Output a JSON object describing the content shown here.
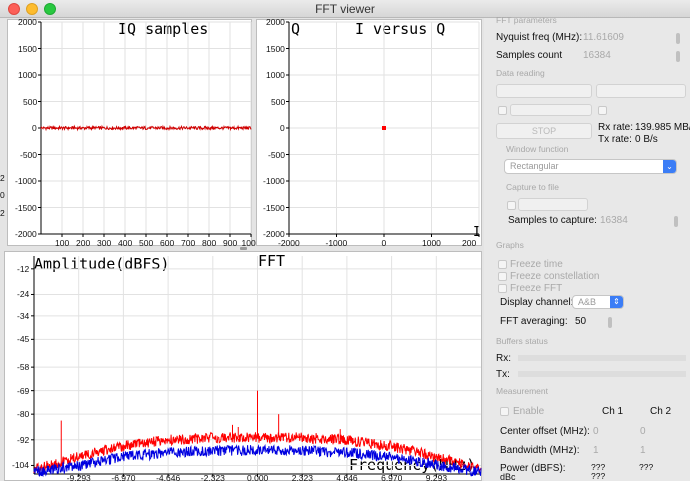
{
  "window": {
    "title": "FFT viewer"
  },
  "iq_plot": {
    "title": "IQ samples",
    "y_ticks": [
      "2000",
      "1500",
      "1000",
      "500",
      "0",
      "-500",
      "-1000",
      "-1500",
      "-2000"
    ],
    "x_ticks": [
      "100",
      "200",
      "300",
      "400",
      "500",
      "600",
      "700",
      "800",
      "900",
      "1000"
    ]
  },
  "iq_vs_plot": {
    "title_left": "Q",
    "title": "I versus Q",
    "corner_label": "I",
    "y_ticks": [
      "2000",
      "1500",
      "1000",
      "500",
      "0",
      "-500",
      "-1000",
      "-1500",
      "-2000"
    ],
    "x_ticks": [
      "-2000",
      "-1000",
      "0",
      "1000",
      "200"
    ]
  },
  "left_edge_ticks": [
    "2",
    "0",
    "2"
  ],
  "fft_plot": {
    "title": "FFT",
    "ylabel": "Amplitude(dBFS)",
    "xlabel": "Frequency(MHz)",
    "y_ticks": [
      "-12",
      "-24",
      "-34",
      "-45",
      "-58",
      "-69",
      "-80",
      "-92",
      "-104"
    ],
    "x_ticks": [
      "-9.293",
      "-6.970",
      "-4.646",
      "-2.323",
      "0.000",
      "2.323",
      "4.646",
      "6.970",
      "9.293"
    ]
  },
  "chart_data": [
    {
      "type": "line",
      "title": "IQ samples",
      "xlim": [
        0,
        1000
      ],
      "ylim": [
        -2000,
        2000
      ],
      "series": [
        {
          "color": "#d00000",
          "x": [
            0,
            1000
          ],
          "y": [
            0,
            0
          ]
        }
      ]
    },
    {
      "type": "scatter",
      "title": "I versus Q",
      "xlim": [
        -2000,
        2000
      ],
      "ylim": [
        -2000,
        2000
      ],
      "series": [
        {
          "color": "#ff0000",
          "x": [
            0
          ],
          "y": [
            0
          ]
        }
      ]
    },
    {
      "type": "line",
      "title": "FFT",
      "xlabel": "Frequency(MHz)",
      "ylabel": "Amplitude(dBFS)",
      "xlim": [
        -11.616,
        11.616
      ],
      "ylim": [
        -108,
        -6
      ],
      "series": [
        {
          "color": "#ff0000",
          "x": [
            -11.6,
            -9.3,
            -7.0,
            -4.6,
            -2.3,
            0,
            2.3,
            4.6,
            7.0,
            9.3,
            11.6
          ],
          "y": [
            -106,
            -100,
            -95,
            -92,
            -91,
            -91,
            -91,
            -92,
            -95,
            -100,
            -106
          ]
        },
        {
          "color": "#0000e0",
          "x": [
            -11.6,
            -9.3,
            -7.0,
            -4.6,
            -2.3,
            0,
            2.3,
            4.6,
            7.0,
            9.3,
            11.6
          ],
          "y": [
            -107,
            -104,
            -100,
            -98,
            -97,
            -97,
            -97,
            -98,
            -100,
            -104,
            -107
          ]
        }
      ],
      "spurs": [
        {
          "x": -10.2,
          "y": -83
        },
        {
          "x": -1.0,
          "y": -86
        },
        {
          "x": 0.0,
          "y": -69
        },
        {
          "x": 1.1,
          "y": -80
        },
        {
          "x": -1.3,
          "y": -85
        },
        {
          "x": 4.3,
          "y": -87
        }
      ]
    }
  ],
  "panel": {
    "fft_params_header": "FFT parameters",
    "nyquist_label": "Nyquist freq (MHz):",
    "nyquist_value": "11.61609",
    "samples_count_label": "Samples count",
    "samples_count_value": "16384",
    "data_reading_header": "Data reading",
    "stop_label": "STOP",
    "rx_rate_label": "Rx rate:",
    "rx_rate_value": "139.985 MB/",
    "tx_rate_label": "Tx rate:",
    "tx_rate_value": "0 B/s",
    "window_function_header": "Window function",
    "window_function_value": "Rectangular",
    "capture_header": "Capture to file",
    "samples_to_capture_label": "Samples to capture:",
    "samples_to_capture_value": "16384",
    "graphs_header": "Graphs",
    "freeze_time": "Freeze time",
    "freeze_constellation": "Freeze constellation",
    "freeze_fft": "Freeze FFT",
    "display_channel_label": "Display channel:",
    "display_channel_value": "A&B",
    "fft_averaging_label": "FFT averaging:",
    "fft_averaging_value": "50",
    "buffers_header": "Buffers status",
    "rx_label": "Rx:",
    "tx_label": "Tx:",
    "measurement_header": "Measurement",
    "enable_label": "Enable",
    "ch1_label": "Ch 1",
    "ch2_label": "Ch 2",
    "center_offset_label": "Center offset (MHz):",
    "center_offset_ch1": "0",
    "center_offset_ch2": "0",
    "bandwidth_label": "Bandwidth (MHz):",
    "bandwidth_ch1": "1",
    "bandwidth_ch2": "1",
    "power_label": "Power (dBFS):",
    "power_ch1": "???",
    "power_ch2": "???",
    "dbc_label": "dBc",
    "dbc_ch1": "???"
  }
}
